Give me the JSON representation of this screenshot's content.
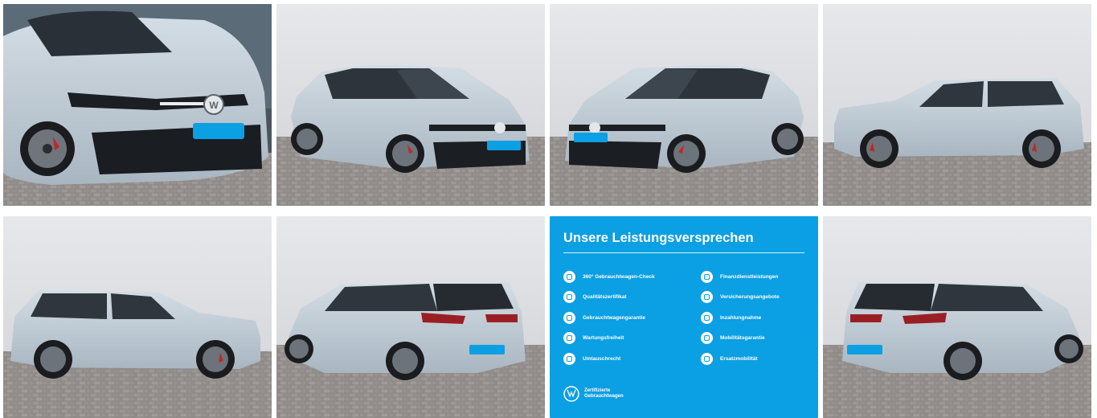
{
  "gallery": {
    "photos": [
      {
        "name": "photo-front-closeup",
        "alt": "Front close-up"
      },
      {
        "name": "photo-front-left",
        "alt": "Front three-quarter left"
      },
      {
        "name": "photo-front-right",
        "alt": "Front three-quarter right"
      },
      {
        "name": "photo-side-right",
        "alt": "Right side"
      },
      {
        "name": "photo-side-left",
        "alt": "Left side"
      },
      {
        "name": "photo-rear-left",
        "alt": "Rear three-quarter left"
      },
      {
        "name": "photo-rear-right",
        "alt": "Rear three-quarter right"
      }
    ]
  },
  "promo": {
    "title": "Unsere Leistungsversprechen",
    "left_items": [
      {
        "label": "360° Gebrauchtwagen-Check",
        "icon": "check-circle-icon"
      },
      {
        "label": "Qualitätszertifikat",
        "icon": "certificate-icon"
      },
      {
        "label": "Gebrauchtwagengarantie",
        "icon": "shield-icon"
      },
      {
        "label": "Wartungsfreiheit",
        "icon": "wrench-icon"
      },
      {
        "label": "Umtauschrecht",
        "icon": "exchange-icon"
      }
    ],
    "right_items": [
      {
        "label": "Finanzdienstleistungen",
        "icon": "finance-icon"
      },
      {
        "label": "Versicherungsangebote",
        "icon": "insurance-icon"
      },
      {
        "label": "Inzahlungnahme",
        "icon": "trade-in-icon"
      },
      {
        "label": "Mobilitätsgarantie",
        "icon": "mobility-icon"
      },
      {
        "label": "Ersatzmobilität",
        "icon": "replacement-car-icon"
      }
    ],
    "badge_line1": "Zertifizierte",
    "badge_line2": "Gebrauchtwagen",
    "colors": {
      "background": "#0b9fe3",
      "text": "#ffffff"
    }
  }
}
